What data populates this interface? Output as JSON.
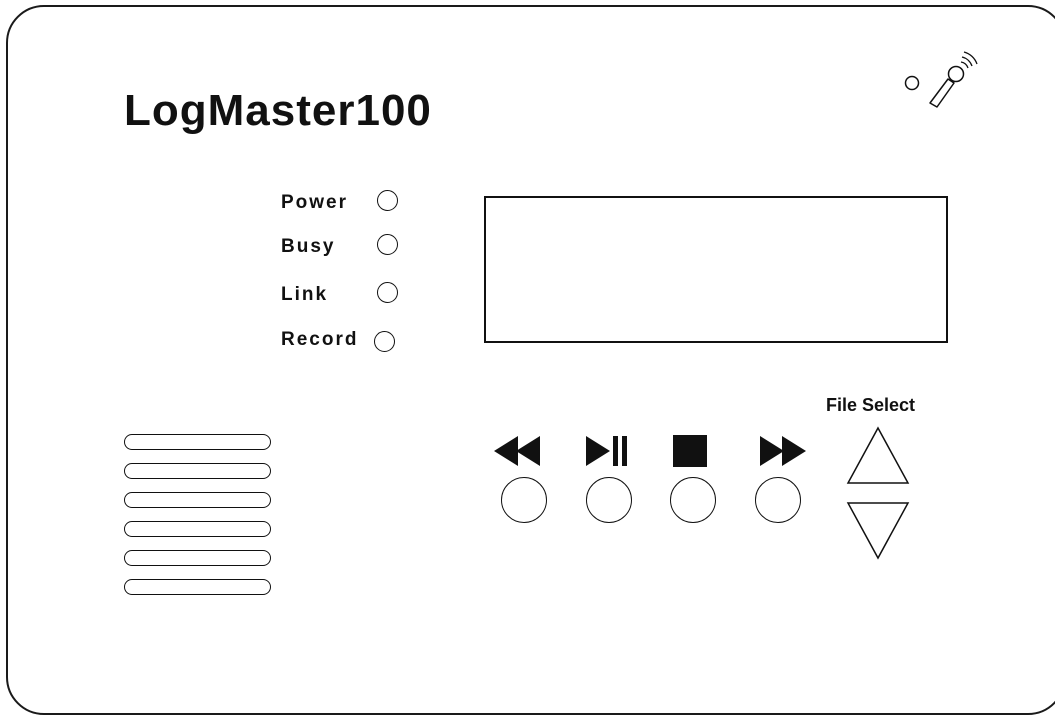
{
  "device": {
    "brand_name": "LogMaster100"
  },
  "indicators": [
    {
      "label": "Power"
    },
    {
      "label": "Busy"
    },
    {
      "label": "Link"
    },
    {
      "label": "Record"
    }
  ],
  "controls": {
    "file_select_label": "File Select",
    "transport": [
      {
        "icon": "rewind-icon"
      },
      {
        "icon": "play-pause-icon"
      },
      {
        "icon": "stop-icon"
      },
      {
        "icon": "fast-forward-icon"
      }
    ],
    "file_select_buttons": [
      {
        "icon": "triangle-up-icon"
      },
      {
        "icon": "triangle-down-icon"
      }
    ]
  },
  "remote": {
    "icons": [
      "ir-receiver-icon",
      "microphone-icon"
    ]
  },
  "colors": {
    "line": "#111111",
    "background": "#ffffff"
  }
}
